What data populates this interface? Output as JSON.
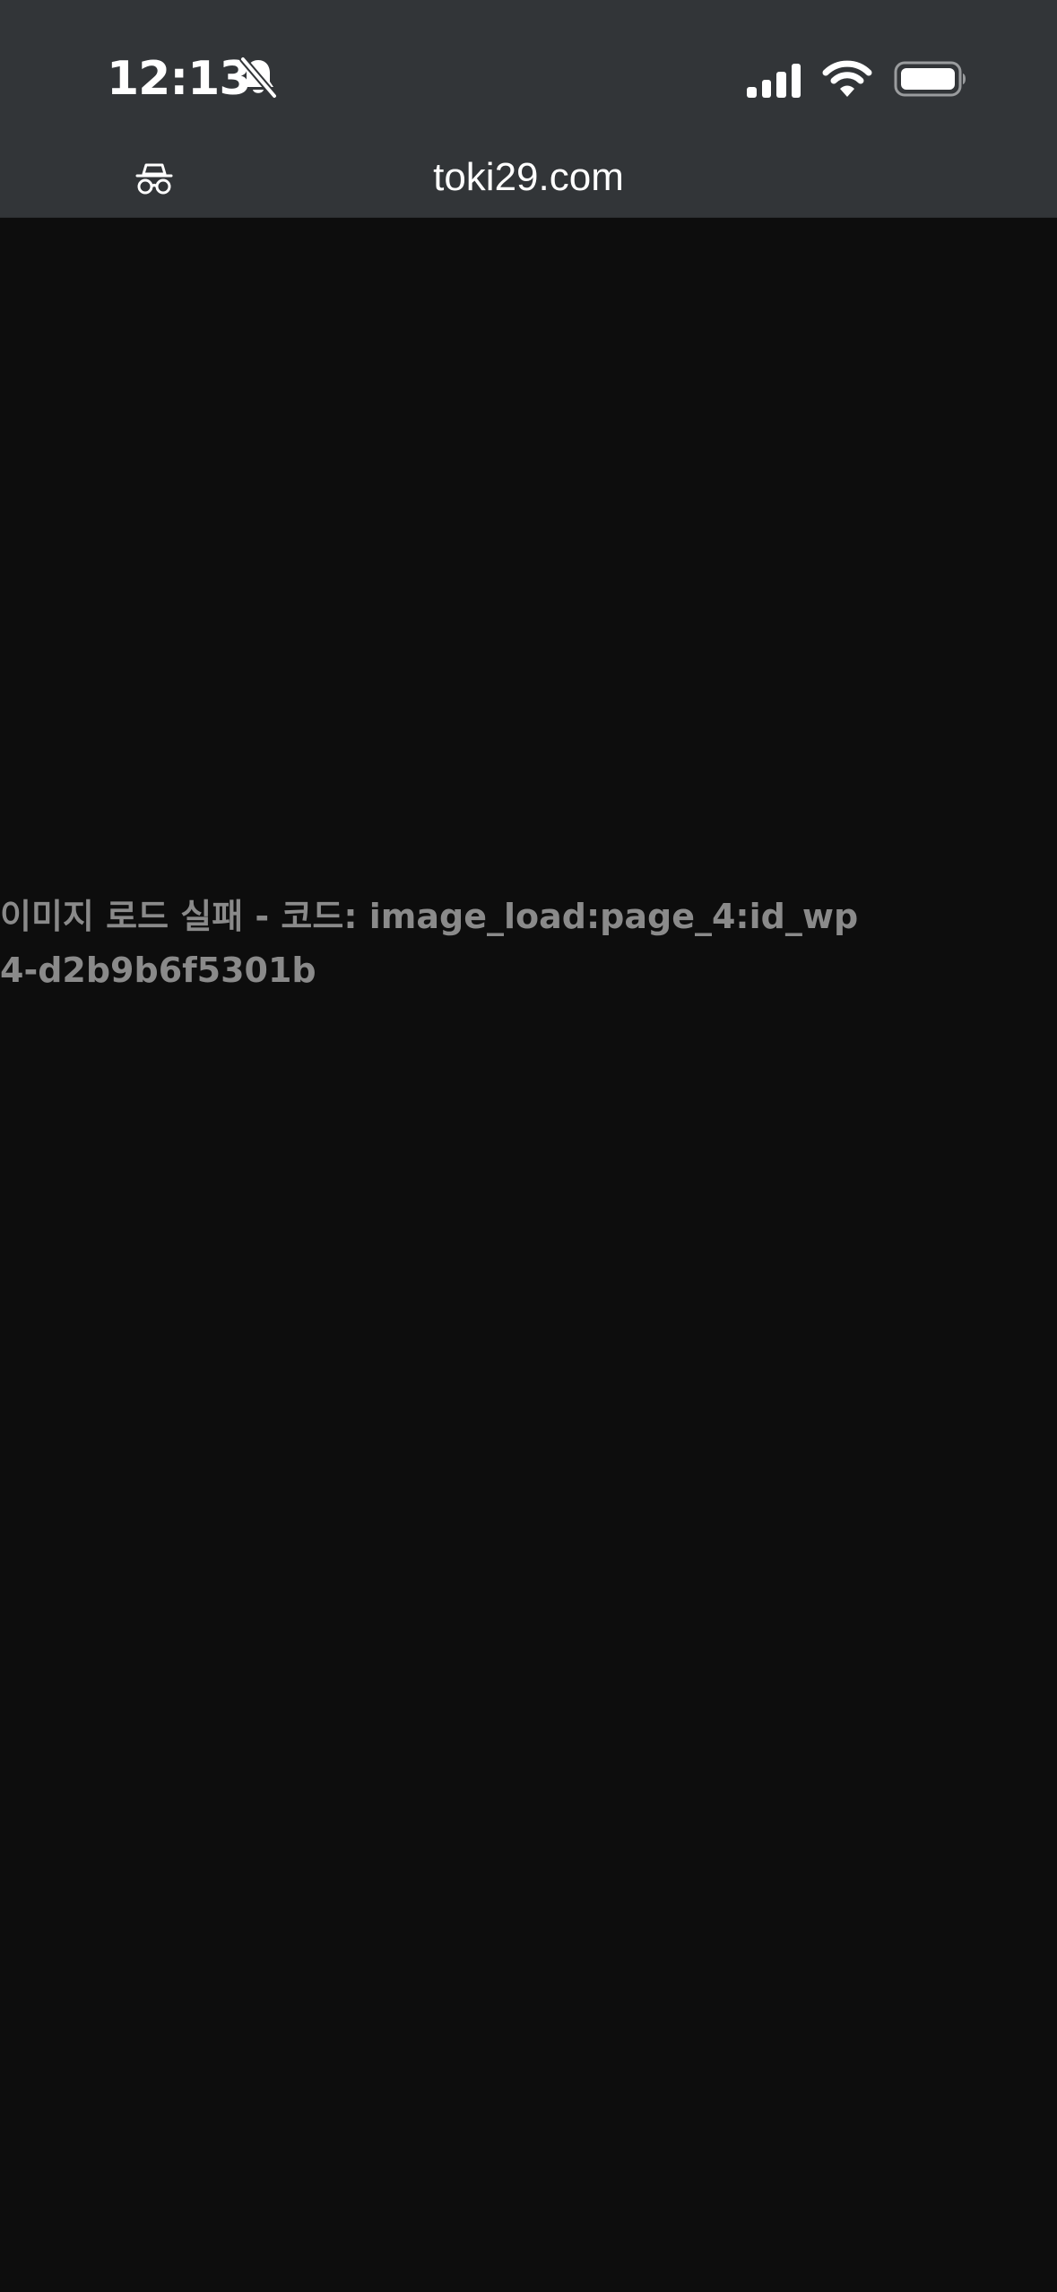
{
  "status_bar": {
    "time": "12:13",
    "icons": [
      "bell-slash-icon",
      "cellular-signal-icon",
      "wifi-icon",
      "battery-icon"
    ]
  },
  "browser": {
    "url": "toki29.com",
    "private_icon": "private-browsing-icon"
  },
  "page": {
    "error_text": "이미지 로드 실패 - 코드: image_load:page_4:id_wp4-d2b9b6f5301b"
  },
  "colors": {
    "chrome_background": "#323538",
    "page_background": "#0d0d0d",
    "error_text": "#8a8a8a",
    "foreground": "#ffffff"
  }
}
